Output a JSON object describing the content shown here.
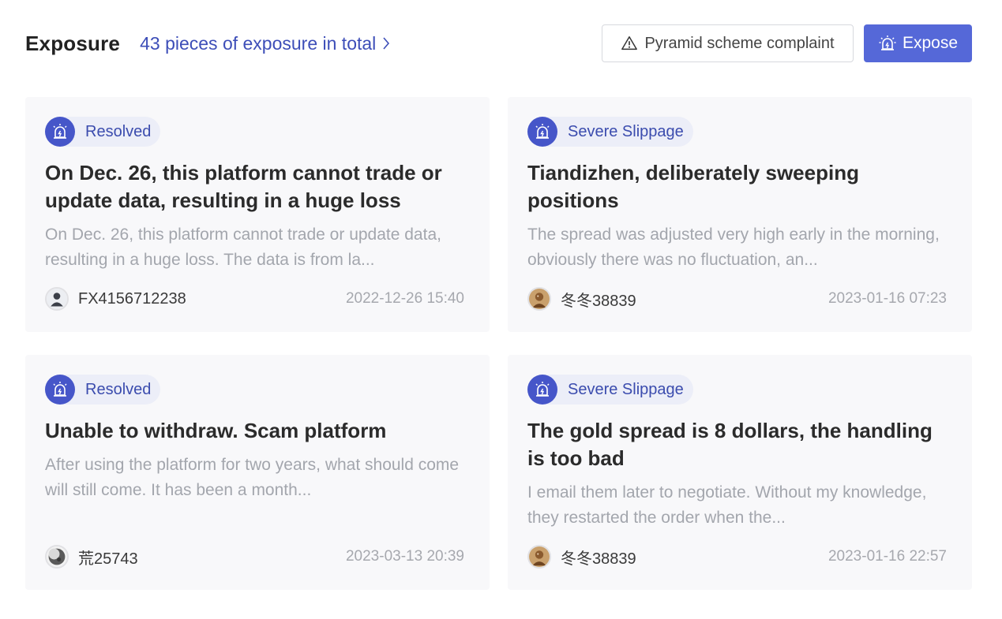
{
  "header": {
    "title": "Exposure",
    "total_link": "43 pieces of exposure in total",
    "complaint_button": "Pyramid scheme complaint",
    "expose_button": "Expose"
  },
  "colors": {
    "accent": "#5568d8",
    "tag_icon_bg": "#4656c9",
    "link": "#3d4eb8",
    "card_bg": "#f8f8fa"
  },
  "cards": [
    {
      "tag": "Resolved",
      "title": "On Dec. 26, this platform cannot trade or update data, resulting in a huge loss",
      "description": "On Dec. 26, this platform cannot trade or update data, resulting in a huge loss. The data is from la...",
      "author": "FX4156712238",
      "avatar": "default-user-avatar",
      "date": "2022-12-26 15:40"
    },
    {
      "tag": "Severe Slippage",
      "title": "Tiandizhen, deliberately sweeping positions",
      "description": "The spread was adjusted very high early in the morning, obviously there was no fluctuation, an...",
      "author": "冬冬38839",
      "avatar": "photo-avatar",
      "date": "2023-01-16 07:23"
    },
    {
      "tag": "Resolved",
      "title": "Unable to withdraw. Scam platform",
      "description": "After using the platform for two years, what should come will still come. It has been a month...",
      "author": "荒25743",
      "avatar": "moon-avatar",
      "date": "2023-03-13 20:39"
    },
    {
      "tag": "Severe Slippage",
      "title": "The gold spread is 8 dollars, the handling is too bad",
      "description": "I email them later to negotiate. Without my knowledge, they restarted the order when the...",
      "author": "冬冬38839",
      "avatar": "photo-avatar",
      "date": "2023-01-16 22:57"
    }
  ]
}
